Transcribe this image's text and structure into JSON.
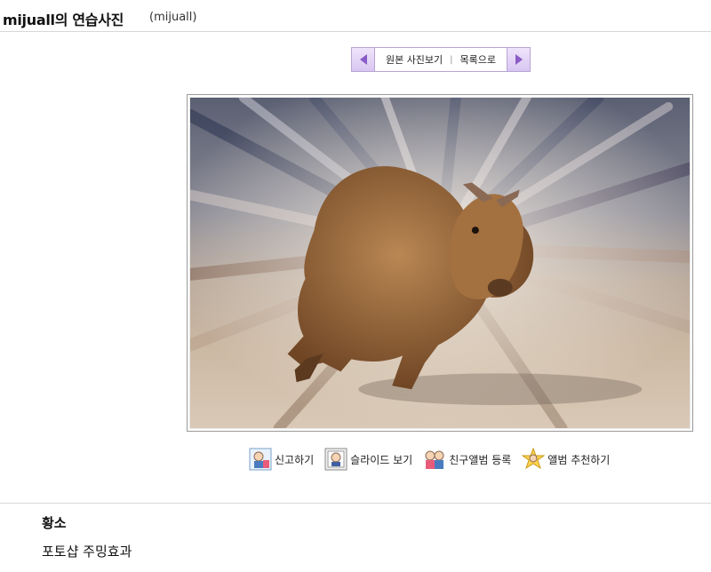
{
  "header": {
    "title": "mijuall의 연습사진",
    "owner": "(mijuall)"
  },
  "nav": {
    "original_label": "원본 사진보기",
    "separator": "|",
    "list_label": "목록으로"
  },
  "actions": [
    {
      "label": "신고하기",
      "icon": "report-icon"
    },
    {
      "label": "슬라이드 보기",
      "icon": "slideshow-icon"
    },
    {
      "label": "친구앨범 등록",
      "icon": "friend-album-icon"
    },
    {
      "label": "앨범 추천하기",
      "icon": "recommend-icon"
    }
  ],
  "description": {
    "title": "황소",
    "text": "포토샵 주밍효과"
  },
  "colors": {
    "nav_border": "#b9a4d6",
    "nav_arrow": "#8a5cc7"
  }
}
